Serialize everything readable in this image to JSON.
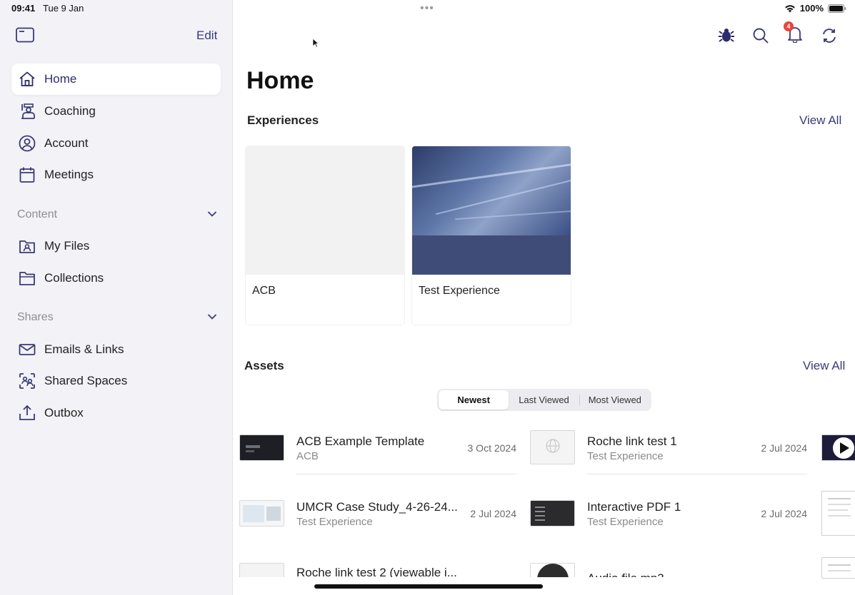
{
  "status": {
    "time": "09:41",
    "date": "Tue 9 Jan",
    "battery": "100%"
  },
  "sidebar": {
    "edit_label": "Edit",
    "items": [
      {
        "label": "Home",
        "icon": "home-icon",
        "active": true
      },
      {
        "label": "Coaching",
        "icon": "coaching-icon"
      },
      {
        "label": "Account",
        "icon": "account-icon"
      },
      {
        "label": "Meetings",
        "icon": "calendar-icon"
      }
    ],
    "content_section": {
      "label": "Content",
      "items": [
        {
          "label": "My Files",
          "icon": "my-files-icon"
        },
        {
          "label": "Collections",
          "icon": "folder-icon"
        }
      ]
    },
    "shares_section": {
      "label": "Shares",
      "items": [
        {
          "label": "Emails & Links",
          "icon": "mail-icon"
        },
        {
          "label": "Shared Spaces",
          "icon": "shared-spaces-icon"
        },
        {
          "label": "Outbox",
          "icon": "outbox-icon"
        }
      ]
    }
  },
  "toolbar": {
    "notification_count": "4"
  },
  "main": {
    "title": "Home",
    "experiences": {
      "title": "Experiences",
      "view_all": "View All",
      "cards": [
        {
          "label": "ACB"
        },
        {
          "label": "Test Experience"
        }
      ]
    },
    "assets": {
      "title": "Assets",
      "view_all": "View All",
      "tabs": [
        "Newest",
        "Last Viewed",
        "Most Viewed"
      ],
      "active_tab": "Newest",
      "left_column": [
        {
          "title": "ACB Example Template",
          "subtitle": "ACB",
          "date": "3 Oct 2024"
        },
        {
          "title": "UMCR Case Study_4-26-24...",
          "subtitle": "Test Experience",
          "date": "2 Jul 2024"
        },
        {
          "title": "Roche link test 2 (viewable i...",
          "subtitle": "",
          "date": ""
        }
      ],
      "right_column": [
        {
          "title": "Roche link test 1",
          "subtitle": "Test Experience",
          "date": "2 Jul 2024"
        },
        {
          "title": "Interactive PDF 1",
          "subtitle": "Test Experience",
          "date": "2 Jul 2024"
        },
        {
          "title": "Audio file mp3",
          "subtitle": "",
          "date": ""
        }
      ]
    }
  },
  "colors": {
    "accent": "#3a3a78",
    "badge": "#e8453c",
    "sidebar_bg": "#f2f2f7"
  }
}
